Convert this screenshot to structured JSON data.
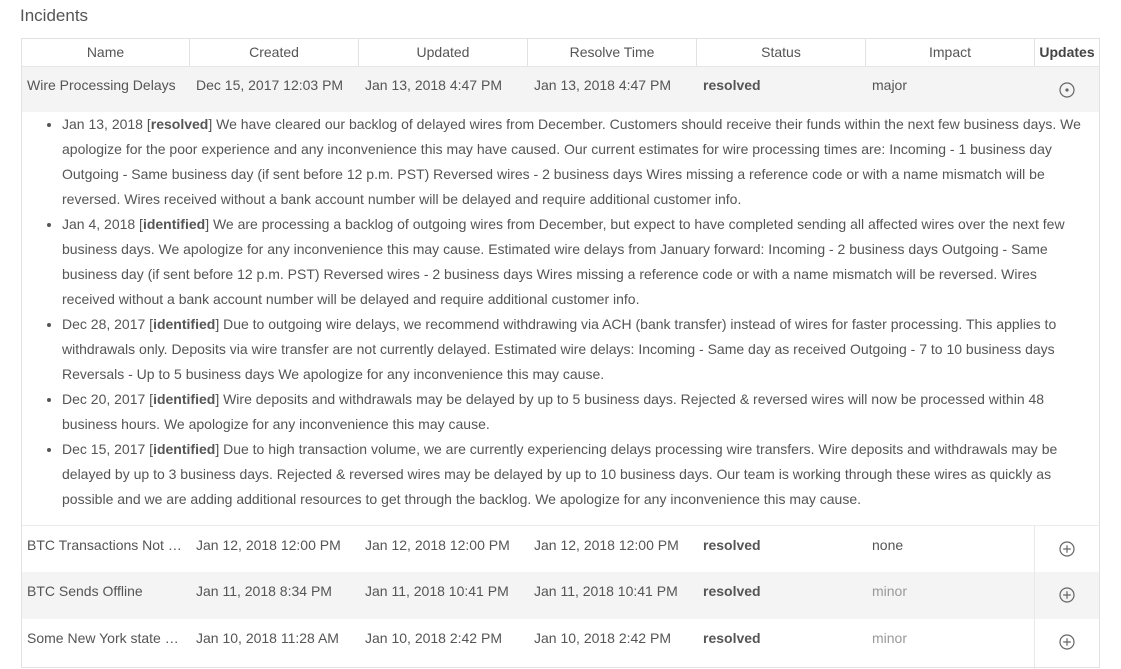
{
  "page": {
    "title": "Incidents"
  },
  "columns": [
    "Name",
    "Created",
    "Updated",
    "Resolve Time",
    "Status",
    "Impact",
    "Updates"
  ],
  "incidents": [
    {
      "name": "Wire Processing Delays",
      "created": "Dec 15, 2017 12:03 PM",
      "updated": "Jan 13, 2018 4:47 PM",
      "resolve_time": "Jan 13, 2018 4:47 PM",
      "status": "resolved",
      "impact": "major",
      "updates_icon": "circle-dot-icon",
      "expanded": true
    },
    {
      "name": "BTC Transactions Not …",
      "created": "Jan 12, 2018 12:00 PM",
      "updated": "Jan 12, 2018 12:00 PM",
      "resolve_time": "Jan 12, 2018 12:00 PM",
      "status": "resolved",
      "impact": "none",
      "updates_icon": "circle-plus-icon"
    },
    {
      "name": "BTC Sends Offline",
      "created": "Jan 11, 2018 8:34 PM",
      "updated": "Jan 11, 2018 10:41 PM",
      "resolve_time": "Jan 11, 2018 10:41 PM",
      "status": "resolved",
      "impact": "minor",
      "updates_icon": "circle-plus-icon"
    },
    {
      "name": "Some New York state a…",
      "created": "Jan 10, 2018 11:28 AM",
      "updated": "Jan 10, 2018 2:42 PM",
      "resolve_time": "Jan 10, 2018 2:42 PM",
      "status": "resolved",
      "impact": "minor",
      "updates_icon": "circle-plus-icon"
    }
  ],
  "updates": [
    {
      "date": "Jan 13, 2018",
      "status": "resolved",
      "text": "We have cleared our backlog of delayed wires from December. Customers should receive their funds within the next few business days. We apologize for the poor experience and any inconvenience this may have caused.  Our current estimates for wire processing times are: Incoming - 1 business day Outgoing - Same business day (if sent before 12 p.m. PST)  Reversed wires - 2 business days   Wires missing a reference code or with a name mismatch will be reversed. Wires received without a bank account number will be delayed and require additional customer info."
    },
    {
      "date": "Jan 4, 2018",
      "status": "identified",
      "text": "We are processing a backlog of outgoing wires from December, but expect to have completed sending all affected wires over the next few business days. We apologize for any inconvenience this may cause.  Estimated wire delays from January forward: Incoming - 2 business days Outgoing - Same business day (if sent before 12 p.m. PST) Reversed wires - 2 business days  Wires missing a reference code or with a name mismatch will be reversed. Wires received without a bank account number will be delayed and require additional customer info."
    },
    {
      "date": "Dec 28, 2017",
      "status": "identified",
      "text": "Due to outgoing wire delays, we recommend withdrawing via ACH (bank transfer) instead of wires for faster processing. This applies to withdrawals only. Deposits via wire transfer are not currently delayed.  Estimated wire delays: Incoming - Same day as received Outgoing - 7 to 10 business days Reversals - Up to 5 business days  We apologize for any inconvenience this may cause."
    },
    {
      "date": "Dec 20, 2017",
      "status": "identified",
      "text": "Wire deposits and withdrawals may be delayed by up to 5 business days. Rejected & reversed wires will now be processed within 48 business hours. We apologize for any inconvenience this may cause."
    },
    {
      "date": "Dec 15, 2017",
      "status": "identified",
      "text": "Due to high transaction volume, we are currently experiencing delays processing wire transfers. Wire deposits and withdrawals may be delayed by up to 3 business days. Rejected & reversed wires may be delayed by up to 10 business days. Our team is working through these wires as quickly as possible and we are adding additional resources to get through the backlog. We apologize for any inconvenience this may cause."
    }
  ]
}
